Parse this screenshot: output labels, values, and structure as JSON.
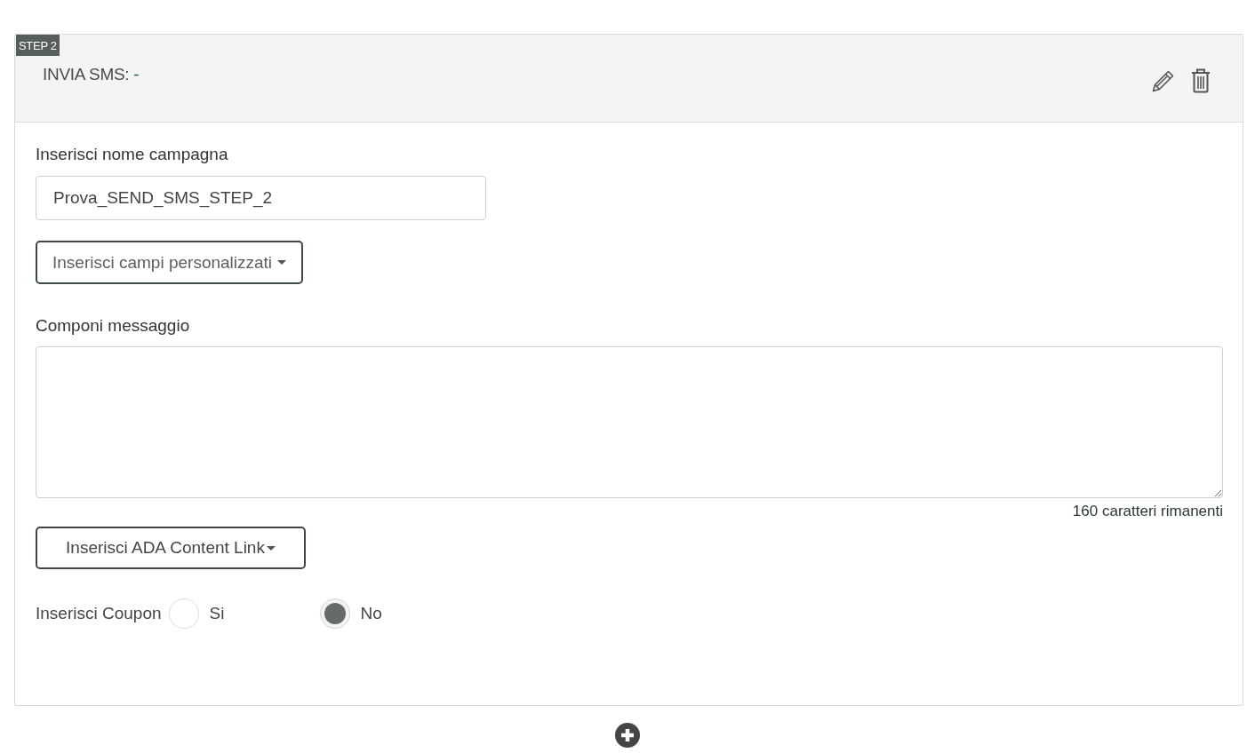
{
  "step": {
    "badge": "STEP 2",
    "title": "INVIA SMS:",
    "value": "-"
  },
  "campaign_name": {
    "label": "Inserisci nome campagna",
    "value": "Prova_SEND_SMS_STEP_2"
  },
  "custom_fields_dropdown": {
    "label": "Inserisci campi personalizzati"
  },
  "message": {
    "label": "Componi messaggio",
    "counter": "160 caratteri rimanenti"
  },
  "content_link_dropdown": {
    "label": "Inserisci ADA Content Link"
  },
  "coupon": {
    "label": "Inserisci Coupon",
    "options": [
      {
        "label": "Si",
        "selected": false
      },
      {
        "label": "No",
        "selected": true
      }
    ]
  }
}
